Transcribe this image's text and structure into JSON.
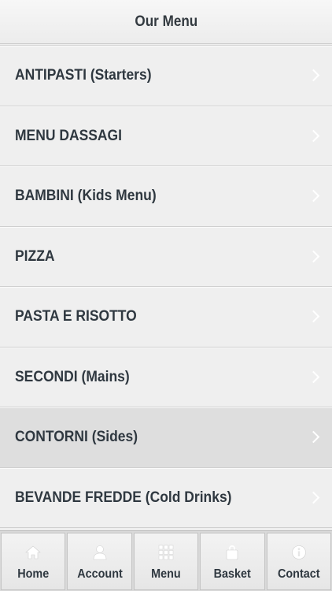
{
  "header": {
    "title": "Our Menu"
  },
  "menu": {
    "items": [
      {
        "label": "ANTIPASTI (Starters)"
      },
      {
        "label": "MENU DASSAGI"
      },
      {
        "label": "BAMBINI (Kids Menu)"
      },
      {
        "label": "PIZZA"
      },
      {
        "label": "PASTA E RISOTTO"
      },
      {
        "label": "SECONDI (Mains)"
      },
      {
        "label": "CONTORNI (Sides)"
      },
      {
        "label": "BEVANDE FREDDE (Cold Drinks)"
      }
    ],
    "active_index": 6
  },
  "tabbar": {
    "tabs": [
      {
        "label": "Home",
        "icon": "home-icon"
      },
      {
        "label": "Account",
        "icon": "user-icon"
      },
      {
        "label": "Menu",
        "icon": "grid-icon"
      },
      {
        "label": "Basket",
        "icon": "bag-icon"
      },
      {
        "label": "Contact",
        "icon": "info-icon"
      }
    ]
  },
  "colors": {
    "background": "#eeeeee",
    "text": "#2f3840",
    "active_row": "#dedede",
    "icon": "#ffffff"
  }
}
